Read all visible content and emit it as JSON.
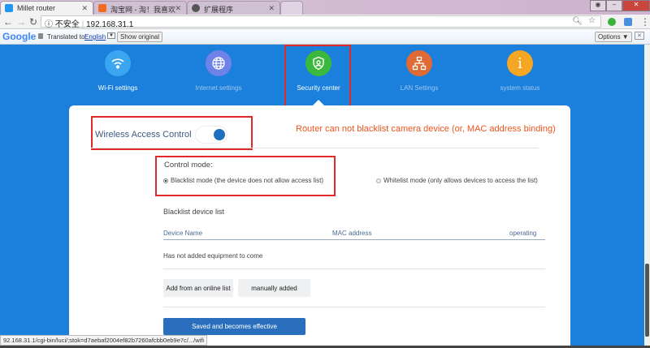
{
  "browser": {
    "tabs": [
      {
        "title": "Millet router",
        "active": true
      },
      {
        "title": "淘宝网 - 淘！我喜欢",
        "active": false
      },
      {
        "title": "扩展程序",
        "active": false
      }
    ],
    "security_label": "不安全",
    "url": "192.168.31.1",
    "translate": {
      "logo": "Google",
      "translated_to": "Translated to:",
      "language": "English",
      "show_original": "Show original",
      "options": "Options ▼"
    },
    "status_url": "92.168.31.1/cgi-bin/luci/;stok=d7aebaf2004ef82b7260afcbb0eb9e7c/.../wifi"
  },
  "nav": [
    {
      "label": "Wi-Fi settings",
      "icon": "wifi-icon",
      "color": "#3aa6f0"
    },
    {
      "label": "Internet settings",
      "icon": "globe-icon",
      "color": "#6f82e8"
    },
    {
      "label": "Security center",
      "icon": "shield-icon",
      "color": "#3cb83c",
      "active": true
    },
    {
      "label": "LAN Settings",
      "icon": "network-icon",
      "color": "#e06a34"
    },
    {
      "label": "system status",
      "icon": "info-icon",
      "color": "#f5a623"
    }
  ],
  "main": {
    "wac_label": "Wireless Access Control",
    "wac_enabled": true,
    "annotation": "Router can not blacklist camera device (or, MAC address binding)",
    "annotation_color": "#f0541e",
    "control_mode_label": "Control mode:",
    "modes": [
      {
        "label": "Blacklist mode (the device does not allow access list)",
        "selected": true
      },
      {
        "label": "Whitelist mode (only allows devices to access the list)",
        "selected": false
      }
    ],
    "list_title": "Blacklist device list",
    "columns": [
      "Device Name",
      "MAC address",
      "operating"
    ],
    "empty_text": "Has not added equipment to come",
    "add_online": "Add from an online list",
    "add_manual": "manually added",
    "save": "Saved and becomes effective"
  }
}
